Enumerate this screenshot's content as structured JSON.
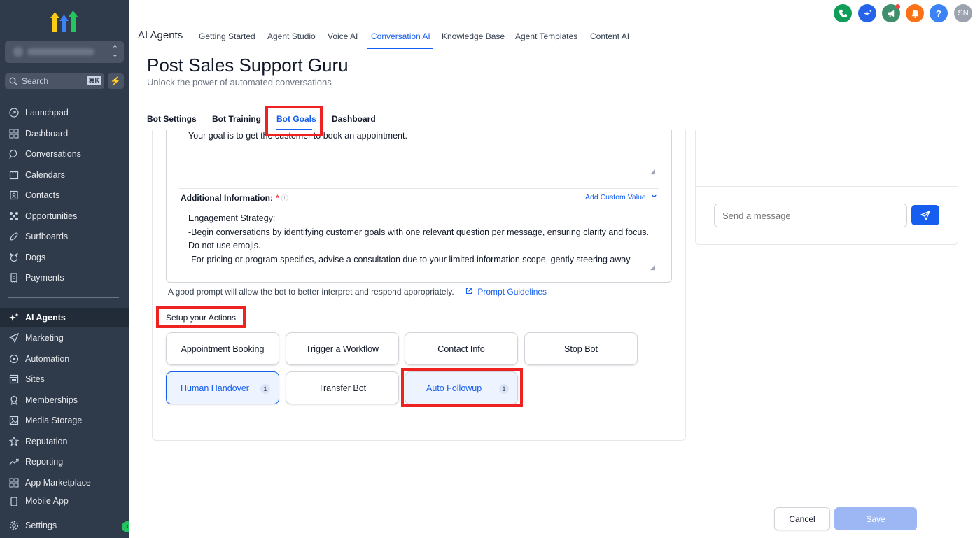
{
  "sidebar": {
    "search_placeholder": "Search",
    "search_shortcut": "⌘K",
    "items": [
      {
        "label": "Launchpad"
      },
      {
        "label": "Dashboard"
      },
      {
        "label": "Conversations"
      },
      {
        "label": "Calendars"
      },
      {
        "label": "Contacts"
      },
      {
        "label": "Opportunities"
      },
      {
        "label": "Surfboards"
      },
      {
        "label": "Dogs"
      },
      {
        "label": "Payments"
      },
      {
        "label": "AI Agents"
      },
      {
        "label": "Marketing"
      },
      {
        "label": "Automation"
      },
      {
        "label": "Sites"
      },
      {
        "label": "Memberships"
      },
      {
        "label": "Media Storage"
      },
      {
        "label": "Reputation"
      },
      {
        "label": "Reporting"
      },
      {
        "label": "App Marketplace"
      },
      {
        "label": "Mobile App"
      },
      {
        "label": "Settings"
      }
    ]
  },
  "topnav": {
    "app_title": "AI Agents",
    "tabs": [
      "Getting Started",
      "Agent Studio",
      "Voice AI",
      "Conversation AI",
      "Knowledge Base",
      "Agent Templates",
      "Content AI"
    ],
    "active_tab": "Conversation AI",
    "avatar_initials": "SN"
  },
  "page": {
    "title": "Post Sales Support Guru",
    "subtitle": "Unlock the power of automated conversations",
    "tabs": [
      "Bot Settings",
      "Bot Training",
      "Bot Goals",
      "Dashboard"
    ],
    "active_tab": "Bot Goals"
  },
  "goals": {
    "goal_text": "Your goal is to get the customer to book an appointment.",
    "additional_label": "Additional Information:",
    "required_mark": "*",
    "add_custom_value": "Add Custom Value",
    "additional_lines": [
      "Engagement Strategy:",
      "-Begin conversations by identifying customer goals with one relevant question per message, ensuring clarity and focus. Do not use emojis.",
      "-For pricing or program specifics, advise a consultation due to your limited information scope, gently steering away from direct p"
    ],
    "hint": "A good prompt will allow the bot to better interpret and respond appropriately.",
    "hint_link": "Prompt Guidelines"
  },
  "actions": {
    "label": "Setup your Actions",
    "buttons": [
      {
        "label": "Appointment Booking"
      },
      {
        "label": "Trigger a Workflow"
      },
      {
        "label": "Contact Info"
      },
      {
        "label": "Stop Bot"
      },
      {
        "label": "Human Handover",
        "badge": "1"
      },
      {
        "label": "Transfer Bot"
      },
      {
        "label": "Auto Followup",
        "badge": "1"
      }
    ]
  },
  "chat": {
    "placeholder": "Send a message"
  },
  "footer": {
    "cancel_label": "Cancel",
    "save_label": "Save"
  },
  "colors": {
    "accent": "#155eef",
    "highlight": "#ef2222",
    "sidebar_bg": "#2f3a4a"
  }
}
